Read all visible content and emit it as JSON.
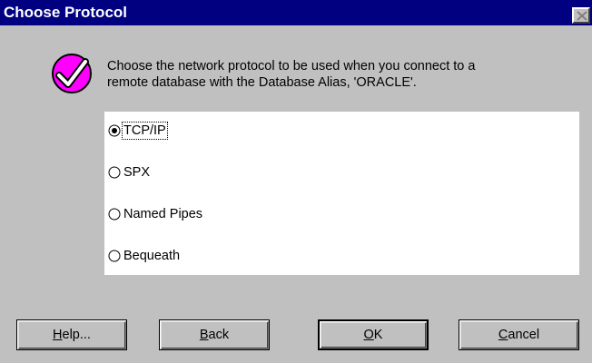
{
  "window": {
    "title": "Choose Protocol"
  },
  "icons": {
    "title_close": "close-icon",
    "main": "checkmark-icon"
  },
  "colors": {
    "titlebar": "#000080",
    "dialog_background": "#c0c0c0",
    "icon_fill": "#ff00ff"
  },
  "message": {
    "line1": "Choose the network protocol to be used when you connect to a",
    "line2": "remote database with the Database Alias, 'ORACLE'."
  },
  "protocols": {
    "selected": "TCP/IP",
    "options": [
      {
        "label": "TCP/IP",
        "checked": true
      },
      {
        "label": "SPX",
        "checked": false
      },
      {
        "label": "Named Pipes",
        "checked": false
      },
      {
        "label": "Bequeath",
        "checked": false
      }
    ]
  },
  "buttons": {
    "help": {
      "mnemonic": "H",
      "rest": "elp..."
    },
    "back": {
      "mnemonic": "B",
      "rest": "ack"
    },
    "ok": {
      "mnemonic": "O",
      "rest": "K"
    },
    "cancel": {
      "mnemonic": "C",
      "rest": "ancel"
    }
  }
}
